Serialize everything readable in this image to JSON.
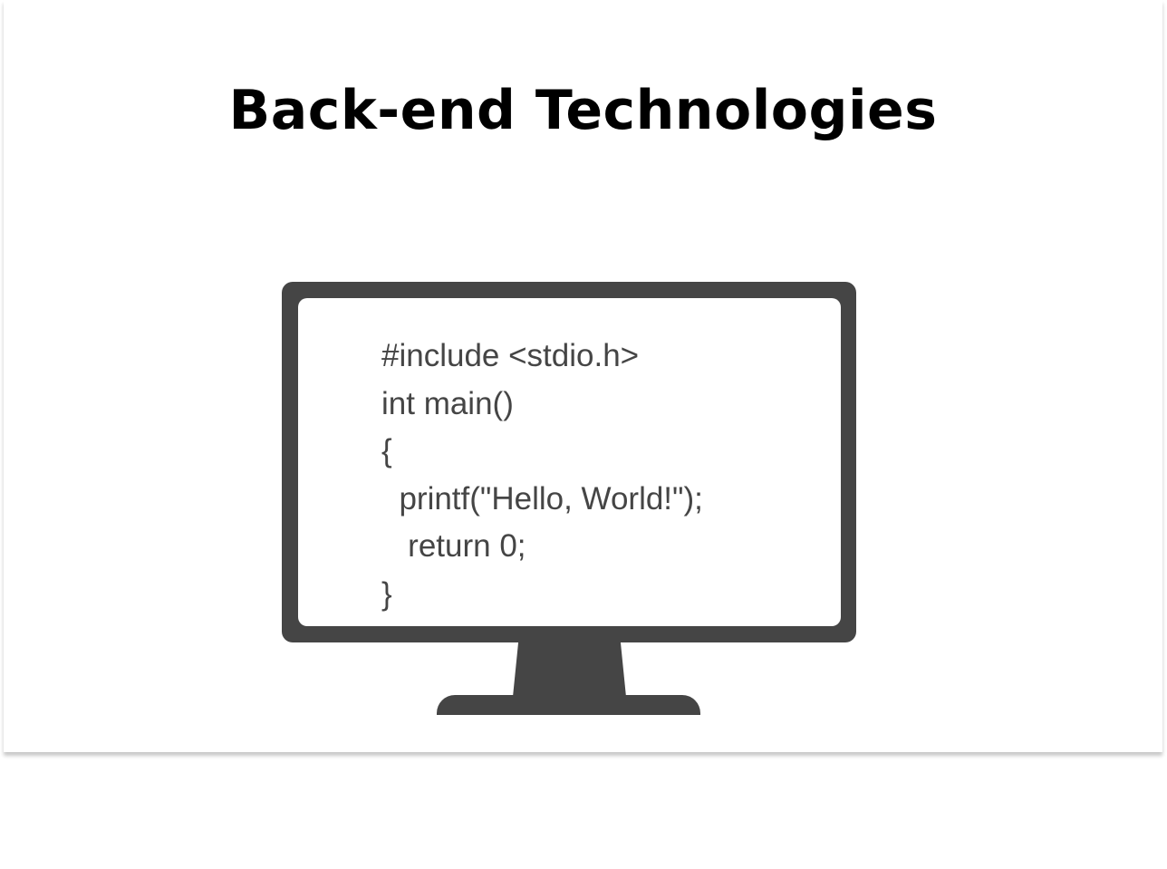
{
  "slide": {
    "title": "Back-end Technologies"
  },
  "illustration": {
    "icon": "monitor-with-code-icon",
    "monitor_color": "#454545",
    "code_lines": [
      "#include <stdio.h>",
      "int main()",
      "{",
      "  printf(\"Hello, World!\");",
      "   return 0;",
      "}"
    ]
  }
}
